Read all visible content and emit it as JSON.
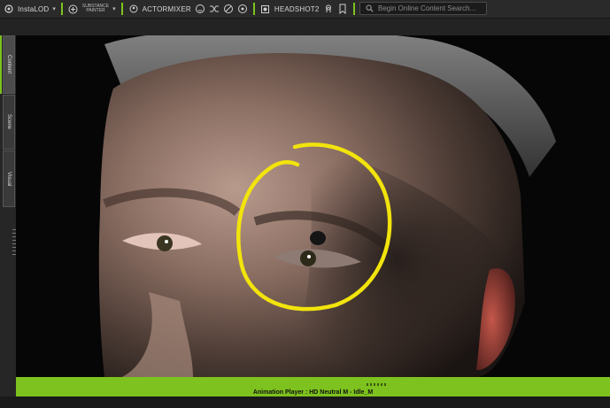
{
  "toolbar": {
    "instalod_label": "InstaLOD",
    "substance_line1": "SUBSTANCE",
    "substance_line2": "PAINTER",
    "actormixer_label": "ACTORMIXER",
    "headshot_label": "HEADSHOT2"
  },
  "search": {
    "placeholder": "Begin Online Content Search..."
  },
  "side_tabs": [
    "Content",
    "Scene",
    "Visual"
  ],
  "animation_player": {
    "title": "Animation Player : HD Neutral M - Idle_M"
  },
  "colors": {
    "accent": "#7dc21e",
    "annotation": "#f2e40c"
  }
}
